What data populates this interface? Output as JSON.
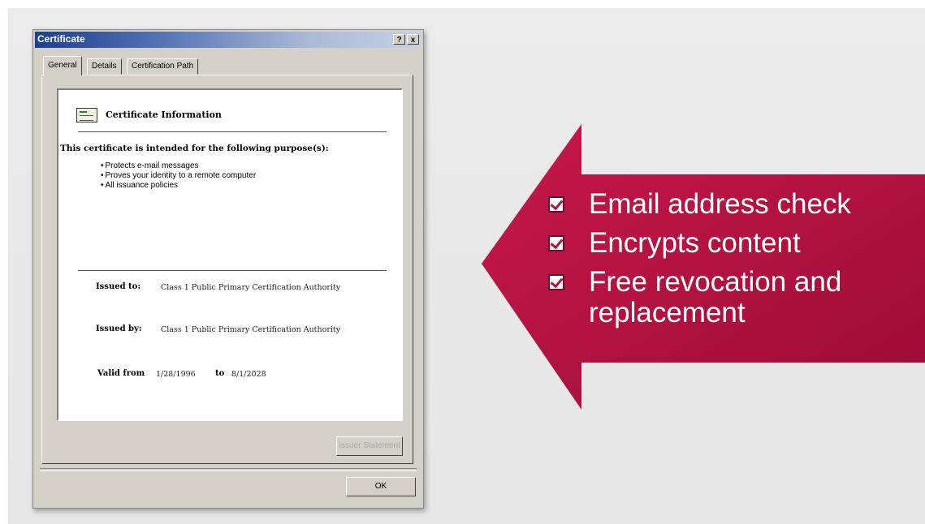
{
  "window": {
    "title": "Certificate",
    "help_button": "?",
    "close_button": "x",
    "tabs": [
      "General",
      "Details",
      "Certification Path"
    ],
    "active_tab": "General"
  },
  "general": {
    "heading": "Certificate Information",
    "purpose_heading": "This certificate is intended for the following purpose(s):",
    "purposes": [
      "Protects e-mail messages",
      "Proves your identity to a remote computer",
      "All issuance policies"
    ],
    "issued_to_label": "Issued to:",
    "issued_to_value": "Class 1 Public Primary Certification Authority",
    "issued_by_label": "Issued by:",
    "issued_by_value": "Class 1 Public Primary Certification Authority",
    "valid_from_label": "Valid from",
    "valid_from_value": "1/28/1996",
    "valid_to_label": "to",
    "valid_to_value": "8/1/2028"
  },
  "buttons": {
    "issuer_statement": "Issuer Statement",
    "ok": "OK"
  },
  "callout": {
    "color": "#b4123f",
    "features": [
      "Email address check",
      "Encrypts content",
      "Free revocation and replacement"
    ]
  }
}
